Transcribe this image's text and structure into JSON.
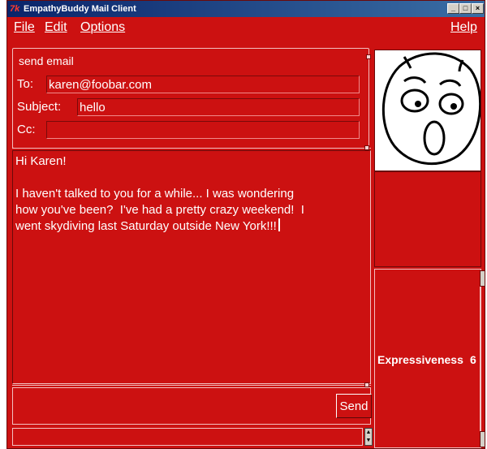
{
  "window": {
    "title": "EmpathyBuddy Mail Client",
    "icon": "tk-feather-icon"
  },
  "title_controls": {
    "minimize": "_",
    "maximize": "□",
    "close": "×"
  },
  "menu": {
    "file": "File",
    "edit": "Edit",
    "options": "Options",
    "help": "Help"
  },
  "compose": {
    "legend": "send email",
    "to_label": "To:",
    "to_value": "karen@foobar.com",
    "subject_label": "Subject:",
    "subject_value": "hello",
    "cc_label": "Cc:",
    "cc_value": ""
  },
  "message": {
    "body": "Hi Karen!\n\nI haven't talked to you for a while... I was wondering\nhow you've been?  I've had a pretty crazy weekend!  I\nwent skydiving last Saturday outside New York!!!"
  },
  "actions": {
    "send": "Send"
  },
  "expressiveness": {
    "label": "Expressiveness",
    "value": "6"
  },
  "avatar": {
    "expression": "surprised-face"
  }
}
